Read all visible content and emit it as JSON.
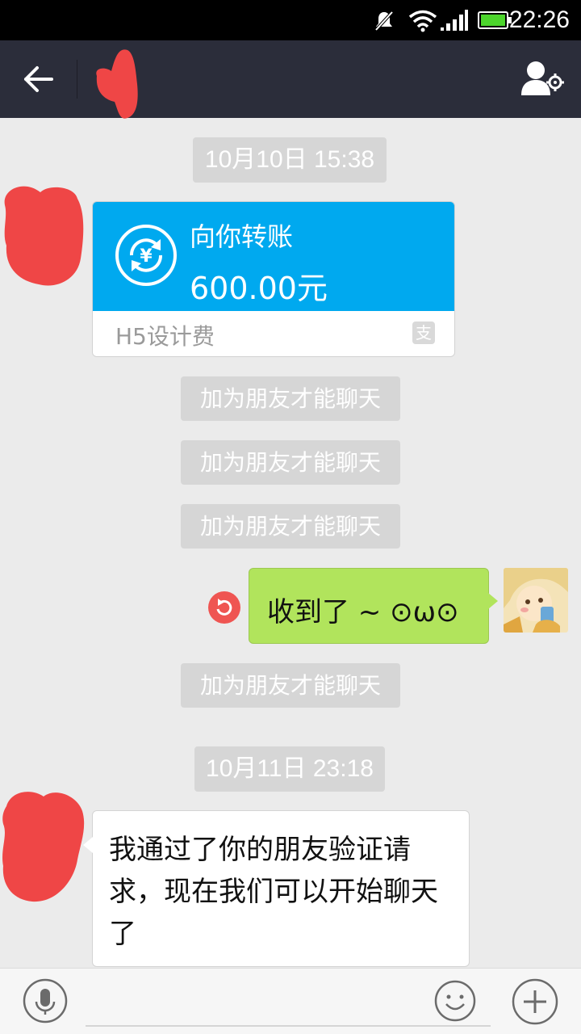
{
  "status_bar": {
    "time": "22:26",
    "icons": [
      "muted-notification-icon",
      "wifi-icon",
      "signal-icon",
      "battery-icon"
    ]
  },
  "nav": {
    "back_icon": "back-arrow-icon",
    "profile_icon": "profile-settings-icon"
  },
  "messages": {
    "timestamp_1": "10月10日 15:38",
    "transfer": {
      "title": "向你转账",
      "amount": "600.00元",
      "memo": "H5设计费",
      "icon": "transfer-yuan-icon",
      "brand_icon": "alipay-icon",
      "brand_char": "支"
    },
    "system_notice_1": "加为朋友才能聊天",
    "system_notice_2": "加为朋友才能聊天",
    "system_notice_3": "加为朋友才能聊天",
    "my_message": "收到了 ~ ⊙ω⊙",
    "resend_icon": "resend-icon",
    "system_notice_4": "加为朋友才能聊天",
    "timestamp_2": "10月11日 23:18",
    "friend_message": "我通过了你的朋友验证请求，现在我们可以开始聊天了"
  },
  "input_bar": {
    "voice_icon": "microphone-icon",
    "input_value": "",
    "emoji_icon": "smiley-icon",
    "plus_icon": "plus-icon"
  },
  "colors": {
    "nav_bg": "#2b2d3a",
    "transfer_blue": "#00a9ef",
    "my_bubble": "#b1e45c",
    "redaction": "#ef4646"
  }
}
